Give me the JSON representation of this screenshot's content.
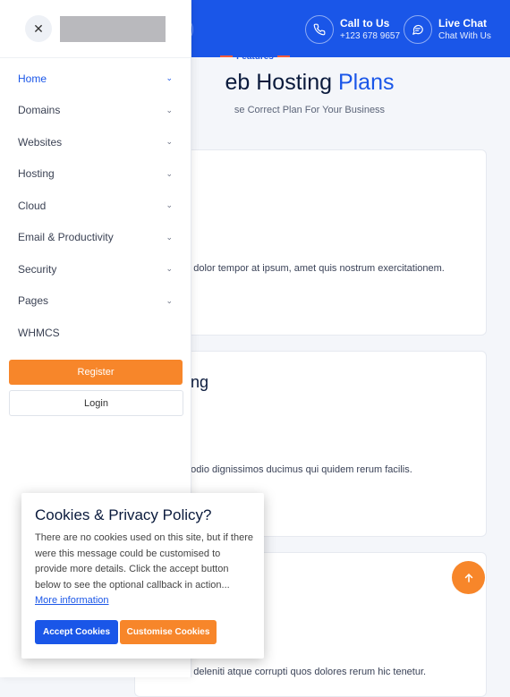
{
  "header": {
    "call": {
      "title": "Call to Us",
      "phone": "+123 678 9657",
      "icon": "phone-icon"
    },
    "chat": {
      "title": "Live Chat",
      "subtitle": "Chat With Us",
      "icon": "chat-icon"
    }
  },
  "section": {
    "eyebrow": "Features",
    "title_main": "eb Hosting ",
    "title_accent": "Plans",
    "subtitle": "se Correct Plan For Your Business"
  },
  "cards": [
    {
      "title": "",
      "text": "et dolor tempor at ipsum, amet quis nostrum exercitationem."
    },
    {
      "title": "ting",
      "text": "o odio dignissimos ducimus qui quidem rerum facilis."
    },
    {
      "title": "",
      "text": "m deleniti atque corrupti quos dolores rerum hic tenetur."
    }
  ],
  "drawer": {
    "close_icon": "close-icon",
    "menu": [
      {
        "label": "Home",
        "chevron": true,
        "active": true
      },
      {
        "label": "Domains",
        "chevron": true
      },
      {
        "label": "Websites",
        "chevron": true
      },
      {
        "label": "Hosting",
        "chevron": true
      },
      {
        "label": "Cloud",
        "chevron": true
      },
      {
        "label": "Email & Productivity",
        "chevron": true
      },
      {
        "label": "Security",
        "chevron": true
      },
      {
        "label": "Pages",
        "chevron": true
      },
      {
        "label": "WHMCS",
        "chevron": false
      }
    ],
    "register_label": "Register",
    "login_label": "Login"
  },
  "cookie": {
    "title": "Cookies & Privacy Policy?",
    "body": "There are no cookies used on this site, but if there were this message could be customised to provide more details. Click the accept button below to see the optional callback in action...",
    "link": "More information",
    "accept_label": "Accept Cookies",
    "customise_label": "Customise Cookies"
  },
  "colors": {
    "primary": "#1a56e8",
    "accent": "#f7862a",
    "dash": "#f05a3c"
  },
  "scroll_top_icon": "arrow-up-icon"
}
